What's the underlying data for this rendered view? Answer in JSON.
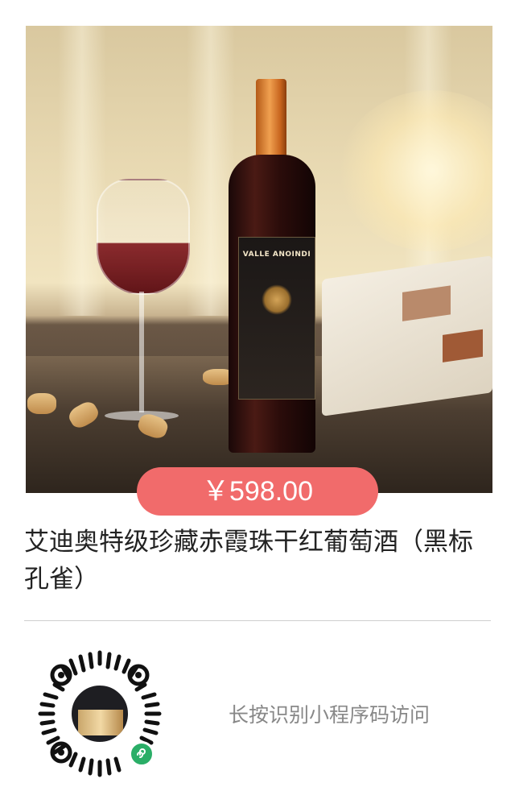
{
  "product": {
    "image_icon": "wine-bottle-photo",
    "price": "￥598.00",
    "title": "艾迪奥特级珍藏赤霞珠干红葡萄酒（黑标孔雀）",
    "bottle_label_brand": "VALLE ANOINDI"
  },
  "share": {
    "qr_icon": "mini-program-code",
    "badge_icon": "mini-program-logo-icon",
    "hint": "长按识别小程序码访问"
  },
  "colors": {
    "price_pill": "#f16b6b",
    "mini_program_green": "#2aae67"
  }
}
